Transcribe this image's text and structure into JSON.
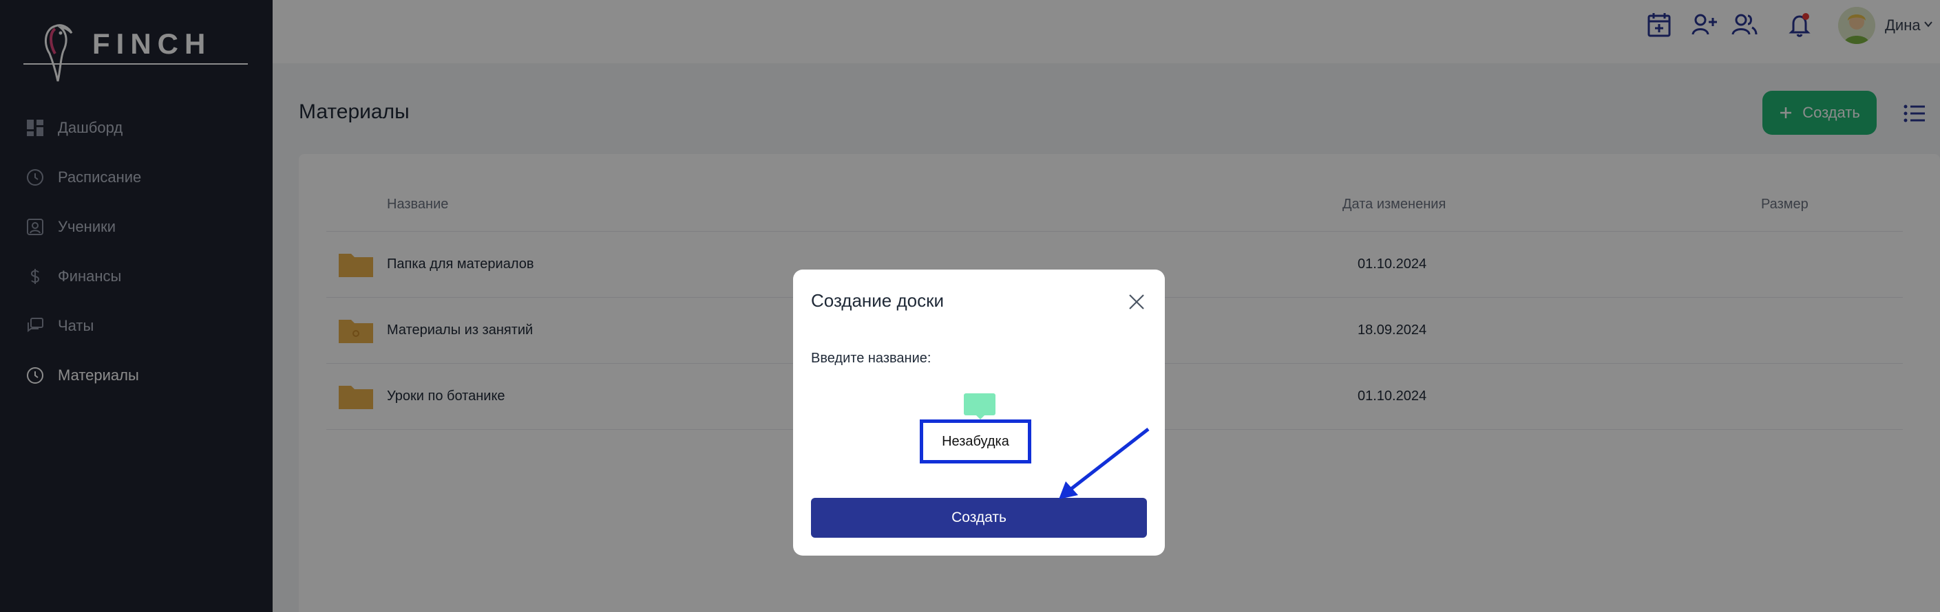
{
  "brand": {
    "name": "FINCH"
  },
  "sidebar": {
    "items": [
      {
        "label": "Дашборд",
        "icon": "dashboard-icon"
      },
      {
        "label": "Расписание",
        "icon": "clock-icon"
      },
      {
        "label": "Ученики",
        "icon": "student-icon"
      },
      {
        "label": "Финансы",
        "icon": "dollar-icon"
      },
      {
        "label": "Чаты",
        "icon": "chat-icon"
      },
      {
        "label": "Материалы",
        "icon": "clock-icon",
        "active": true
      }
    ]
  },
  "topbar": {
    "user_name": "Дина",
    "icons": [
      "calendar-add-icon",
      "add-user-icon",
      "users-icon",
      "bell-icon"
    ],
    "accent": "#283593"
  },
  "main": {
    "title": "Материалы",
    "create_button_label": "Создать",
    "table": {
      "columns": [
        "Название",
        "Дата изменения",
        "Размер"
      ],
      "rows": [
        {
          "name": "Папка для материалов",
          "date": "01.10.2024"
        },
        {
          "name": "Материалы из занятий",
          "date": "18.09.2024"
        },
        {
          "name": "Уроки по ботанике",
          "date": "01.10.2024"
        }
      ]
    }
  },
  "modal": {
    "title": "Создание доски",
    "label": "Введите название:",
    "input_value": "Незабудка",
    "submit_label": "Создать"
  },
  "colors": {
    "sidebar_bg": "#1f2330",
    "create_button": "#22b573",
    "folder": "#e8b04c",
    "modal_button": "#283593",
    "highlight": "#1130d8"
  }
}
